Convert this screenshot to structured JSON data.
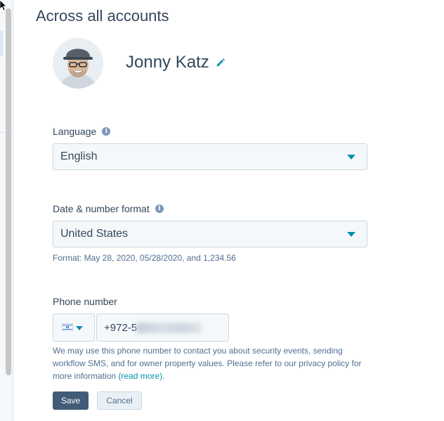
{
  "section": {
    "title": "Across all accounts"
  },
  "profile": {
    "name": "Jonny Katz",
    "avatar_icon": "user-photo",
    "edit_icon": "pencil-icon"
  },
  "language": {
    "label": "Language",
    "value": "English"
  },
  "date_format": {
    "label": "Date & number format",
    "value": "United States",
    "hint": "Format: May 28, 2020, 05/28/2020, and 1,234.56"
  },
  "phone": {
    "label": "Phone number",
    "country_flag": "israel-flag-icon",
    "prefix": "+972-5",
    "disclaimer_text": "We may use this phone number to contact you about security events, sending workflow SMS, and for owner property values. Please refer to our privacy policy for more information ",
    "read_more": "(read more)",
    "disclaimer_end": "."
  },
  "buttons": {
    "save": "Save",
    "cancel": "Cancel"
  },
  "colors": {
    "accent": "#0091ae",
    "primary_button": "#425b76",
    "text": "#33475b"
  }
}
